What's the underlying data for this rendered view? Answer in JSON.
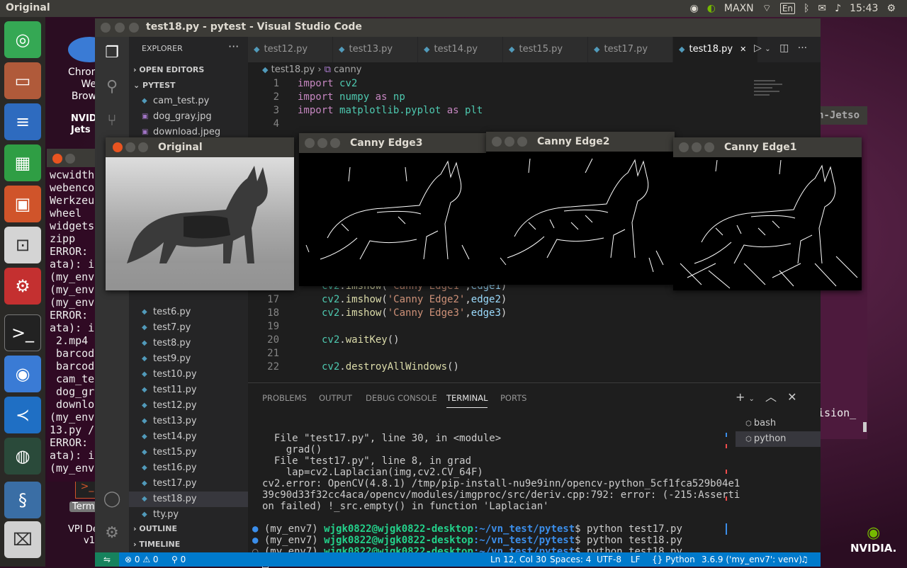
{
  "top_panel": {
    "title": "Original",
    "indicators": [
      "MAXN",
      "En",
      "15:43"
    ]
  },
  "desktop": {
    "chrome_label": "Chrom\nWe\nBrow",
    "term_label": "Term",
    "nvidia_label": "NVIDI\nJets",
    "vpi_label": "VPI De\nv1",
    "bg_terminal_lines": [
      "wcwidth",
      "webenco",
      "Werkzeu",
      "wheel",
      "widgets",
      "zipp",
      "ERROR:",
      "ata): i",
      "(my_env",
      "(my_env",
      "(my_env",
      "ERROR:",
      "ata): i",
      " 2.mp4",
      " barcod",
      " barcod",
      " cam_te",
      " dog_gr",
      " downlo",
      "(my_env",
      "13.py /",
      "ERROR:",
      "ata): i",
      "(my_env"
    ],
    "bg_terminal_right": [
      "h-Jetso",
      "ision_"
    ]
  },
  "vscode": {
    "window_title": "test18.py - pytest - Visual Studio Code",
    "explorer_title": "EXPLORER",
    "open_editors": "OPEN EDITORS",
    "folder": "PYTEST",
    "files_top": [
      "cam_test.py",
      "dog_gray.jpg",
      "download.jpeg"
    ],
    "files": [
      "test6.py",
      "test7.py",
      "test8.py",
      "test9.py",
      "test10.py",
      "test11.py",
      "test12.py",
      "test13.py",
      "test14.py",
      "test15.py",
      "test16.py",
      "test17.py",
      "test18.py",
      "tty.py"
    ],
    "outline": "OUTLINE",
    "timeline": "TIMELINE",
    "tabs": [
      "test12.py",
      "test13.py",
      "test14.py",
      "test15.py",
      "test17.py",
      "test18.py"
    ],
    "breadcrumb": [
      "test18.py",
      "canny"
    ],
    "code_lines": [
      {
        "n": "1",
        "text": "import cv2"
      },
      {
        "n": "2",
        "text": "import numpy as np"
      },
      {
        "n": "3",
        "text": "import matplotlib.pyplot as plt"
      },
      {
        "n": "4",
        "text": ""
      },
      {
        "n": "16",
        "text": "cv2.imshow('Canny Edge1',edge1)"
      },
      {
        "n": "17",
        "text": "cv2.imshow('Canny Edge2',edge2)"
      },
      {
        "n": "18",
        "text": "cv2.imshow('Canny Edge3',edge3)"
      },
      {
        "n": "19",
        "text": ""
      },
      {
        "n": "20",
        "text": "cv2.waitKey()"
      },
      {
        "n": "21",
        "text": ""
      },
      {
        "n": "22",
        "text": "cv2.destroyAllWindows()"
      }
    ],
    "panel_tabs": [
      "PROBLEMS",
      "OUTPUT",
      "DEBUG CONSOLE",
      "TERMINAL",
      "PORTS"
    ],
    "terminal_lines": [
      "  File \"test17.py\", line 30, in <module>",
      "    grad()",
      "  File \"test17.py\", line 8, in grad",
      "    lap=cv2.Laplacian(img,cv2.CV_64F)",
      "cv2.error: OpenCV(4.8.1) /tmp/pip-install-nu9e9inn/opencv-python_5cf1fca529b04e1",
      "39c90d33f32cc4aca/opencv/modules/imgproc/src/deriv.cpp:792: error: (-215:Asserti",
      "on failed) !_src.empty() in function 'Laplacian'"
    ],
    "prompts": [
      {
        "env": "(my_env7)",
        "user": "wjgk0822@wjgk0822-desktop",
        "path": ":~/vn_test/pytest",
        "cmd": "$ python test17.py"
      },
      {
        "env": "(my_env7)",
        "user": "wjgk0822@wjgk0822-desktop",
        "path": ":~/vn_test/pytest",
        "cmd": "$ python test18.py"
      },
      {
        "env": "(my_env7)",
        "user": "wjgk0822@wjgk0822-desktop",
        "path": ":~/vn_test/pytest",
        "cmd": "$ python test18.py"
      }
    ],
    "terminal_list": [
      "bash",
      "python"
    ],
    "status": {
      "problems": "⊗ 0 ⚠ 0",
      "ports": "⚲ 0",
      "position": "Ln 12, Col 30",
      "spaces": "Spaces: 4",
      "encoding": "UTF-8",
      "eol": "LF",
      "language": "Python",
      "interpreter": "3.6.9 ('my_env7': venv)"
    }
  },
  "image_windows": {
    "original": "Original",
    "edge3": "Canny Edge3",
    "edge2": "Canny Edge2",
    "edge1": "Canny Edge1"
  },
  "brand": "NVIDIA."
}
